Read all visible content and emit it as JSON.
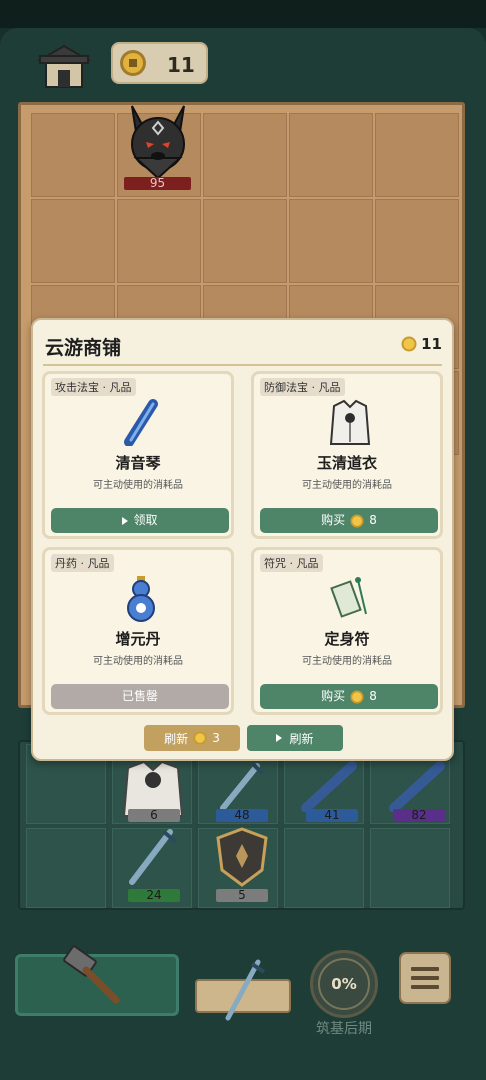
{
  "header": {
    "home_icon": "house-icon",
    "coins": "11"
  },
  "enemy": {
    "icon": "black-wolf-icon",
    "hp": "95"
  },
  "shop": {
    "title": "云游商铺",
    "coins": "11",
    "items": [
      {
        "tag": "攻击法宝 · 凡品",
        "name": "清音琴",
        "desc": "可主动使用的消耗品",
        "icon": "flute-icon",
        "button": "领取",
        "button_type": "ad",
        "price": ""
      },
      {
        "tag": "防御法宝 · 凡品",
        "name": "玉清道衣",
        "desc": "可主动使用的消耗品",
        "icon": "robe-icon",
        "button": "购买",
        "button_type": "buy",
        "price": "8"
      },
      {
        "tag": "丹药 · 凡品",
        "name": "增元丹",
        "desc": "可主动使用的消耗品",
        "icon": "gourd-icon",
        "button": "已售罄",
        "button_type": "soldout",
        "price": ""
      },
      {
        "tag": "符咒 · 凡品",
        "name": "定身符",
        "desc": "可主动使用的消耗品",
        "icon": "talisman-icon",
        "button": "购买",
        "button_type": "buy",
        "price": "8"
      }
    ],
    "refresh_paid_label": "刷新",
    "refresh_paid_price": "3",
    "refresh_ad_label": "刷新"
  },
  "bag": {
    "items": [
      {
        "icon": "robe-icon",
        "level": "6"
      },
      {
        "icon": "sword-icon",
        "level": "48"
      },
      {
        "icon": "flute-icon",
        "level": "41"
      },
      {
        "icon": "flute-icon",
        "level": "82"
      },
      {
        "icon": "sword-icon",
        "level": "24"
      },
      {
        "icon": "shield-icon",
        "level": "5"
      }
    ]
  },
  "bottom": {
    "progress": "0%",
    "stage": "筑基后期"
  },
  "colors": {
    "shop_button_green": "#4e8468",
    "sold_out_gray": "#b1aaa6",
    "coin_gold": "#e0b33c",
    "enemy_hp_red": "#7d1f1f",
    "level_gray": "#7c7c7c",
    "level_blue": "#2d5b9a",
    "level_purple": "#5a2f8a",
    "level_green": "#2f7a3a"
  }
}
